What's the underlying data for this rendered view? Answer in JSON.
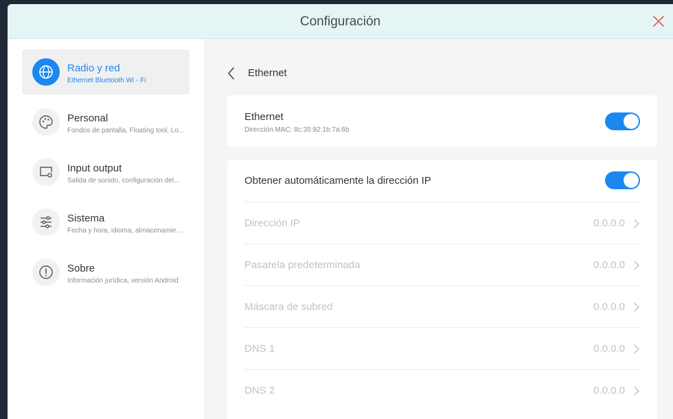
{
  "window": {
    "title": "Configuración",
    "close_icon": "close-icon",
    "accent_color": "#1a88f0",
    "close_color": "#e8584b"
  },
  "sidebar": {
    "items": [
      {
        "title": "Radio y red",
        "subtitle": "Ethernet Bluetooth Wi - Fi",
        "icon": "globe-icon",
        "active": true
      },
      {
        "title": "Personal",
        "subtitle": "Fondos de pantalla, Floating tool, Lo...",
        "icon": "palette-icon",
        "active": false
      },
      {
        "title": "Input output",
        "subtitle": "Salida de sonido, configuración del...",
        "icon": "monitor-settings-icon",
        "active": false
      },
      {
        "title": "Sistema",
        "subtitle": "Fecha y hora, idioma, almacenamien...",
        "icon": "sliders-icon",
        "active": false
      },
      {
        "title": "Sobre",
        "subtitle": "Información jurídica, versión Android",
        "icon": "info-icon",
        "active": false
      }
    ]
  },
  "content": {
    "heading": "Ethernet",
    "ethernet": {
      "title": "Ethernet",
      "mac": "Dirección MAC: 8c:35:92:1b:7a:6b",
      "enabled": true
    },
    "auto_ip": {
      "label": "Obtener automáticamente la dirección IP",
      "enabled": true
    },
    "rows": [
      {
        "label": "Dirección IP",
        "value": "0.0.0.0"
      },
      {
        "label": "Pasarela predeterminada",
        "value": "0.0.0.0"
      },
      {
        "label": "Máscara de subred",
        "value": "0.0.0.0"
      },
      {
        "label": "DNS 1",
        "value": "0.0.0.0"
      },
      {
        "label": "DNS 2",
        "value": "0.0.0.0"
      }
    ]
  }
}
